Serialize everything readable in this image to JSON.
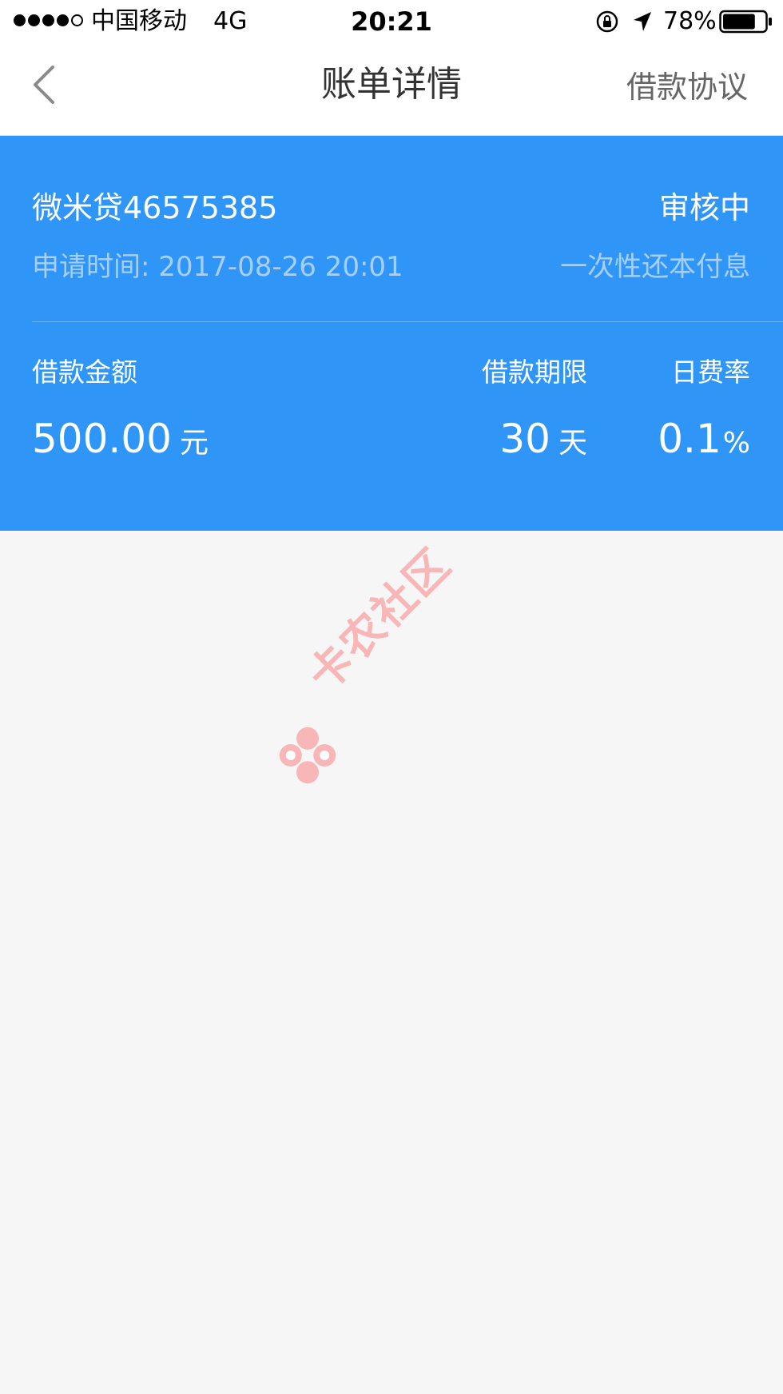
{
  "status_bar": {
    "carrier": "中国移动",
    "network": "4G",
    "time": "20:21",
    "battery": "78%",
    "signal_bars": 4,
    "signal_total": 5,
    "battery_level": 0.78
  },
  "nav": {
    "title": "账单详情",
    "right_action": "借款协议",
    "back_icon": "chevron-left-icon"
  },
  "loan": {
    "product_name": "微米贷46575385",
    "status": "审核中",
    "apply_label": "申请时间:",
    "apply_time": "2017-08-26 20:01",
    "repayment_type": "一次性还本付息",
    "amount_label": "借款金额",
    "amount_value": "500.00",
    "amount_unit": "元",
    "term_label": "借款期限",
    "term_value": "30",
    "term_unit": "天",
    "rate_label": "日费率",
    "rate_value": "0.1",
    "rate_unit": "%"
  },
  "watermark": {
    "text": "卡农社区"
  },
  "colors": {
    "card_bg": "#2f96f8",
    "card_subtext": "#a6d0fb",
    "page_bg": "#f6f6f7",
    "watermark": "#f8b6b6"
  }
}
